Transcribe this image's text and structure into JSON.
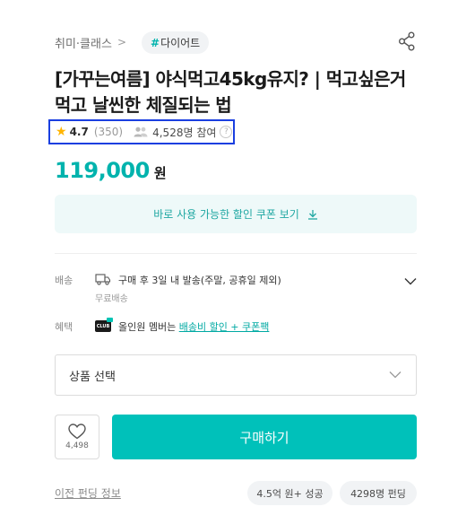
{
  "breadcrumb": {
    "category": "취미·클래스",
    "separator": ">"
  },
  "tag": {
    "hash": "#",
    "label": "다이어트"
  },
  "title": {
    "line1": "[가꾸는여름] 야식먹고45kg유지? | 먹고싶은거",
    "line2": "먹고 날씬한 체질되는 법"
  },
  "rating": {
    "value": "4.7",
    "reviews": "(350)",
    "participants": "4,528명 참여",
    "help": "?"
  },
  "price": {
    "amount": "119,000",
    "unit": "원"
  },
  "coupon": {
    "label": "바로 사용 가능한 할인 쿠폰 보기"
  },
  "shipping": {
    "label": "배송",
    "text": "구매 후 3일 내 발송(주말, 공휴일 제외)",
    "sub": "무료배송"
  },
  "benefit": {
    "label": "혜택",
    "club_badge": "CLUB",
    "text": "올인원 멤버는 ",
    "link": "배송비 할인 + 쿠폰팩"
  },
  "option": {
    "placeholder": "상품 선택"
  },
  "like": {
    "count": "4,498"
  },
  "buy": {
    "label": "구매하기"
  },
  "footer": {
    "prev_funding": "이전 펀딩 정보",
    "amount_chip": "4.5억 원+ 성공",
    "funding_chip": "4298명 펀딩"
  },
  "colors": {
    "accent": "#00c1ba",
    "price": "#00b3ad",
    "star": "#ffb400",
    "highlight_border": "#1a3fe0"
  }
}
